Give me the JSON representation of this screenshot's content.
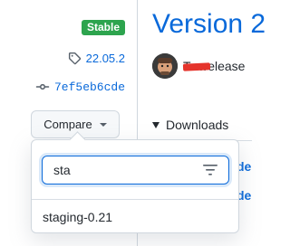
{
  "sidebar": {
    "badge": "Stable",
    "tag": "22.05.2",
    "commit": "7ef5eb6cde",
    "compare_label": "Compare"
  },
  "compare_menu": {
    "filter_value": "sta",
    "options": [
      "staging-0.21"
    ]
  },
  "release": {
    "title": "Version 2",
    "author": "T…release",
    "downloads_label": "Downloads",
    "asset_fragments": [
      "de",
      "de"
    ]
  },
  "colors": {
    "accent": "#0969da",
    "badge_green": "#2da44e"
  },
  "icons": [
    "tag-icon",
    "git-commit-icon",
    "chevron-down-icon",
    "filter-icon",
    "triangle-down-icon"
  ]
}
